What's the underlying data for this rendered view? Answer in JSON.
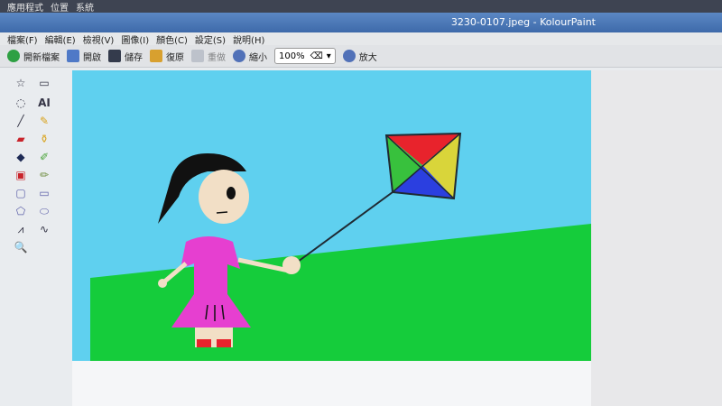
{
  "topbar": {
    "items": [
      "應用程式",
      "位置",
      "系統"
    ]
  },
  "window": {
    "title": "3230-0107.jpeg - KolourPaint"
  },
  "menu": {
    "items": [
      "檔案(F)",
      "編輯(E)",
      "檢視(V)",
      "圖像(I)",
      "顏色(C)",
      "設定(S)",
      "說明(H)"
    ]
  },
  "toolbar": {
    "new_label": "開新檔案",
    "open_label": "開啟",
    "save_label": "儲存",
    "undo_label": "復原",
    "redo_label": "重做",
    "zoom_out_label": "縮小",
    "zoom_value": "100%",
    "zoom_in_label": "放大"
  },
  "tools": {
    "text_tool_label": "AI"
  },
  "colors": {
    "sky": "#5fd0ef",
    "grass": "#15cc3b",
    "dress": "#e63fd0",
    "kite_red": "#e8232c",
    "kite_yellow": "#d9d53a",
    "kite_blue": "#2b3fe0",
    "kite_green": "#38c13d"
  }
}
